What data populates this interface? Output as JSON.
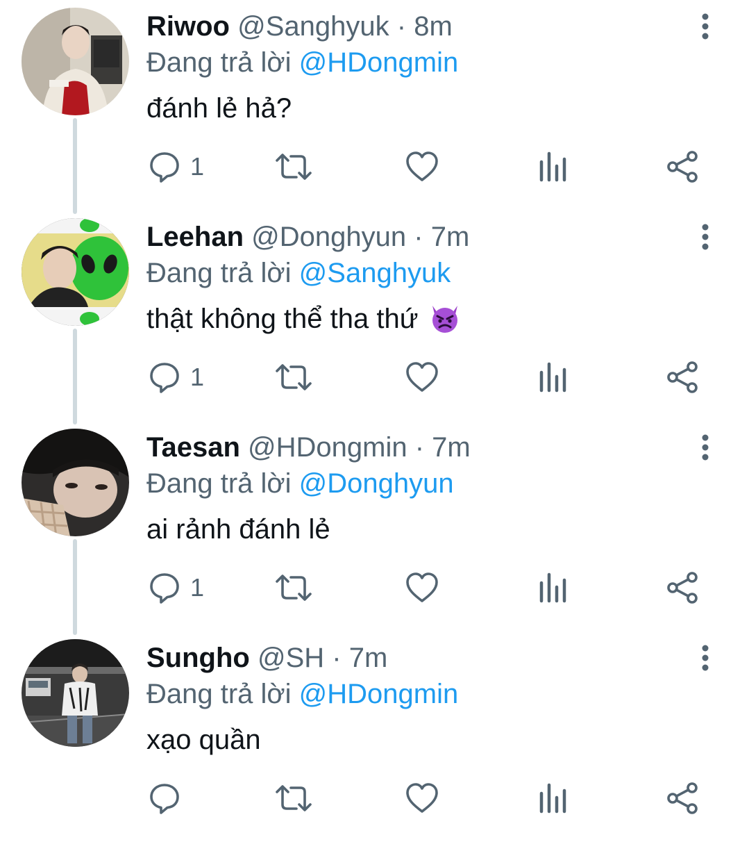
{
  "tweets": [
    {
      "name": "Riwoo",
      "handle": "@Sanghyuk",
      "separator": "·",
      "time": "8m",
      "reply_prefix": "Đang trả lời",
      "reply_to": "@HDongmin",
      "text": "đánh lẻ hả?",
      "emoji": "",
      "reply_count": "1"
    },
    {
      "name": "Leehan",
      "handle": "@Donghyun",
      "separator": "·",
      "time": "7m",
      "reply_prefix": "Đang trả lời",
      "reply_to": "@Sanghyuk",
      "text": "thật không thể tha thứ",
      "emoji": "angry-devil-emoji",
      "reply_count": "1"
    },
    {
      "name": "Taesan",
      "handle": "@HDongmin",
      "separator": "·",
      "time": "7m",
      "reply_prefix": "Đang trả lời",
      "reply_to": "@Donghyun",
      "text": "ai rảnh đánh lẻ",
      "emoji": "",
      "reply_count": "1"
    },
    {
      "name": "Sungho",
      "handle": "@SH",
      "separator": "·",
      "time": "7m",
      "reply_prefix": "Đang trả lời",
      "reply_to": "@HDongmin",
      "text": "xạo quần",
      "emoji": "",
      "reply_count": ""
    }
  ],
  "icons": {
    "reply": "reply-icon",
    "retweet": "retweet-icon",
    "like": "like-icon",
    "views": "views-icon",
    "share": "share-icon",
    "more": "more-options-icon"
  },
  "colors": {
    "text": "#0f1419",
    "secondary": "#536471",
    "mention": "#1d9bf0",
    "thread_line": "#cfd9de"
  }
}
